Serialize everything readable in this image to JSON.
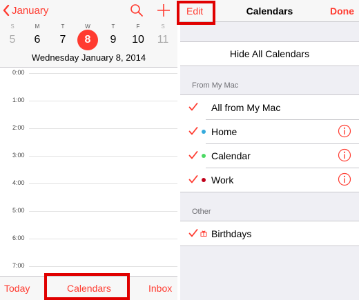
{
  "left_pane": {
    "back_label": "January",
    "week": [
      {
        "letter": "S",
        "num": "5"
      },
      {
        "letter": "M",
        "num": "6"
      },
      {
        "letter": "T",
        "num": "7"
      },
      {
        "letter": "W",
        "num": "8"
      },
      {
        "letter": "T",
        "num": "9"
      },
      {
        "letter": "F",
        "num": "10"
      },
      {
        "letter": "S",
        "num": "11"
      }
    ],
    "selected_day": "8",
    "selected_date": "Wednesday  January 8, 2014",
    "hours": [
      "0:00",
      "1:00",
      "2:00",
      "3:00",
      "4:00",
      "5:00",
      "6:00",
      "7:00"
    ],
    "tabbar": {
      "today": "Today",
      "calendars": "Calendars",
      "inbox": "Inbox"
    }
  },
  "right_pane": {
    "nav": {
      "edit": "Edit",
      "title": "Calendars",
      "done": "Done"
    },
    "hide_all": "Hide All Calendars",
    "sections": [
      {
        "header": "From My Mac",
        "rows": [
          {
            "name": "All from My Mac",
            "checked": true
          },
          {
            "name": "Home",
            "checked": true,
            "color": "#34aadc"
          },
          {
            "name": "Calendar",
            "checked": true,
            "color": "#4cd964"
          },
          {
            "name": "Work",
            "checked": true,
            "color": "#c0001a"
          }
        ]
      },
      {
        "header": "Other",
        "rows": [
          {
            "name": "Birthdays",
            "checked": true,
            "icon": "gift-icon"
          }
        ]
      }
    ]
  },
  "colors": {
    "accent": "#ff3b30",
    "annotation": "#e00000"
  }
}
